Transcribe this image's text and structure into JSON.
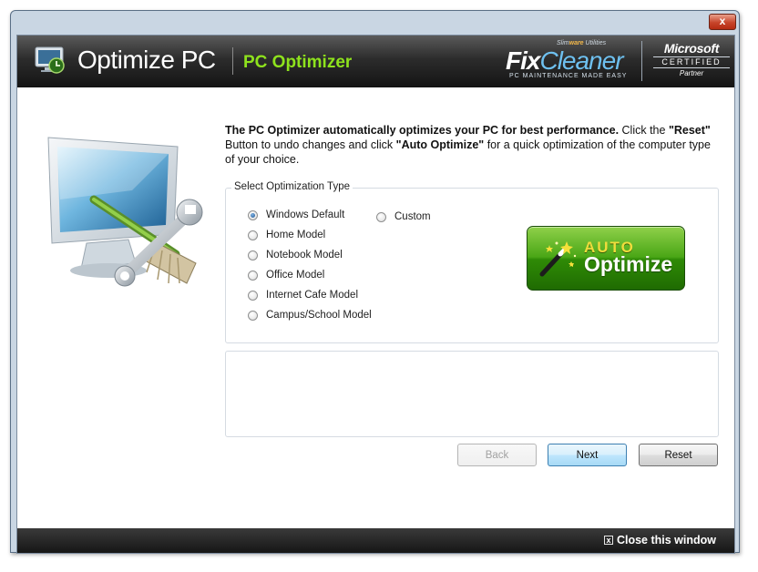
{
  "window": {
    "close_glyph": "x"
  },
  "header": {
    "app_title": "Optimize PC",
    "subtitle": "PC Optimizer",
    "fixcleaner": {
      "small_a": "Slim",
      "small_b": "ware",
      "small_c": " Utilities",
      "fix": "Fix",
      "cleaner": "Cleaner",
      "tagline": "PC MAINTENANCE MADE EASY"
    },
    "microsoft": {
      "name": "Microsoft",
      "certified": "CERTIFIED",
      "partner": "Partner"
    }
  },
  "intro": {
    "part1": "The PC Optimizer automatically optimizes your PC for best performance.",
    "part2": "  Click the ",
    "reset_bold": "\"Reset\"",
    "part3": " Button to undo changes and click ",
    "auto_bold": "\"Auto Optimize\"",
    "part4": " for a quick optimization of the computer type of your choice."
  },
  "optimization": {
    "legend": "Select Optimization Type",
    "options": [
      "Windows Default",
      "Home Model",
      "Notebook Model",
      "Office Model",
      "Internet Cafe Model",
      "Campus/School Model"
    ],
    "custom": "Custom",
    "selected": "Windows Default"
  },
  "auto_optimize": {
    "line1": "AUTO",
    "line2": "Optimize"
  },
  "description": "",
  "buttons": {
    "back": "Back",
    "next": "Next",
    "reset": "Reset"
  },
  "footer": {
    "close_label": "Close this window",
    "close_glyph": "x"
  },
  "colors": {
    "subtitle_green": "#8ee21d",
    "auto_button_green": "#3c9a10",
    "primary_button": "#bee6fd"
  }
}
